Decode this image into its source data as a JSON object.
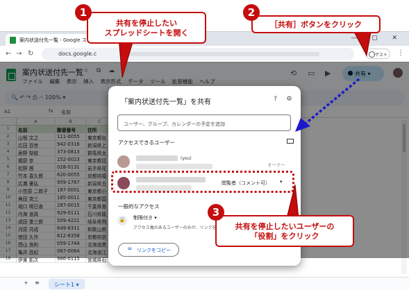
{
  "browser": {
    "tab_title": "案内状送付先一覧 - Google ス…",
    "tab_close": "×",
    "new_tab": "+",
    "address": "docs.google.c",
    "guest": "ゲスト",
    "window_controls": "— ▢ ✕"
  },
  "sheets": {
    "doc_title": "案内状送付先一覧",
    "menus": [
      "ファイル",
      "編集",
      "表示",
      "挿入",
      "表示形式",
      "データ",
      "ツール",
      "拡張機能",
      "ヘルプ"
    ],
    "share_button": "共有",
    "zoom": "100%",
    "cell_ref": "A1",
    "formula": "名前",
    "columns": [
      "A",
      "B",
      "C"
    ],
    "header_row": [
      "名前",
      "郵便番号",
      "住所"
    ],
    "rows": [
      [
        "山根 文之",
        "111-0055",
        "東京都台"
      ],
      [
        "広田 百世",
        "942-0316",
        "新潟県上"
      ],
      [
        "辰野 梨絵",
        "373-0813",
        "群馬県太"
      ],
      [
        "梶原 歩",
        "152-0023",
        "東京都目"
      ],
      [
        "松野 茜",
        "028-0131",
        "岩手県花"
      ],
      [
        "竹本 喜久郎",
        "620-0055",
        "京都府福"
      ],
      [
        "広瀬 憲弘",
        "959-1767",
        "新潟県五"
      ],
      [
        "小笠原 二郎子",
        "187-0001",
        "東京都小"
      ],
      [
        "角田 克三",
        "185-0011",
        "東京都国"
      ],
      [
        "堀口 明日香",
        "287-0015",
        "千葉県香"
      ],
      [
        "内海 道員",
        "929-0111",
        "石川県能"
      ],
      [
        "成田 重三郎",
        "509-4221",
        "岐阜県飛"
      ],
      [
        "河原 共成",
        "649-6311",
        "和歌山県"
      ],
      [
        "徳田 久作",
        "612-8358",
        "京都府京"
      ],
      [
        "西山 良則",
        "059-1744",
        "北海道勇"
      ],
      [
        "亀井 昌紀",
        "067-0064",
        "北海道江"
      ],
      [
        "伊東 凱次",
        "986-0115",
        "宮城県石"
      ]
    ],
    "sheet_tab": "シート1 ▾",
    "add_sheet": "+",
    "sheet_list": "≡"
  },
  "dialog": {
    "title": "「案内状送付先一覧」を共有",
    "help_icon": "?",
    "settings_icon": "⚙",
    "input_placeholder": "ユーザー、グループ、カレンダーの予定を追加",
    "access_users": "アクセスできるユーザー",
    "you": "(you)",
    "owner": "オーナー",
    "role": "閲覧者（コメント可）",
    "role_caret": "▾",
    "general_access": "一般的なアクセス",
    "restricted": "制限付き ▾",
    "restricted_desc": "アクセス権のあるユーザーのみが、リンクを",
    "copy_link": "リンクをコピー"
  },
  "callouts": {
    "c1_num": "1",
    "c1_line1": "共有を停止したい",
    "c1_line2": "スプレッドシートを開く",
    "c2_num": "2",
    "c2_text": "［共有］ボタンをクリック",
    "c3_num": "3",
    "c3_line1": "共有を停止したいユーザーの",
    "c3_line2": "「役割」をクリック"
  },
  "colors": {
    "callout_red": "#c40d0d",
    "arrow_blue": "#1a1acc",
    "share_bg": "#c2e7ff",
    "sheet_green": "#0f9d58"
  }
}
